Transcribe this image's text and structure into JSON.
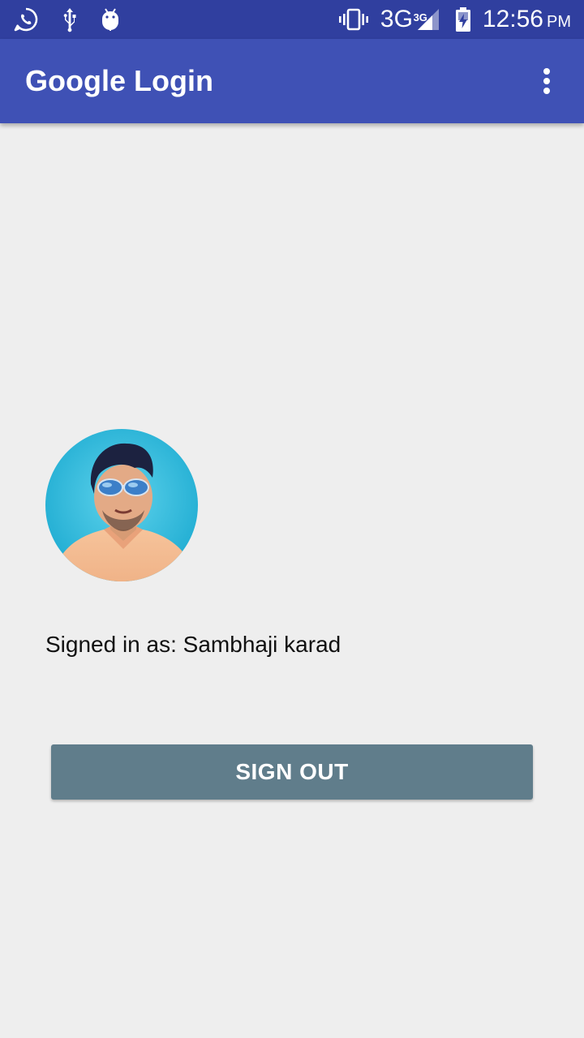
{
  "status_bar": {
    "network_type": "3G",
    "network_sup": "3G",
    "time": "12:56",
    "ampm": "PM",
    "left_icons": [
      "whatsapp-icon",
      "usb-icon",
      "android-debug-icon"
    ],
    "right_icons": [
      "vibrate-icon",
      "signal-icon",
      "battery-charging-icon"
    ],
    "background_color": "#303F9F"
  },
  "app_bar": {
    "title": "Google Login",
    "menu_icon": "more-vert-icon",
    "background_color": "#3F51B5"
  },
  "profile": {
    "avatar_icon": "profile-photo",
    "signed_in_text": "Signed in as: Sambhaji karad"
  },
  "actions": {
    "sign_out_label": "SIGN OUT",
    "button_color": "#607D8B"
  }
}
